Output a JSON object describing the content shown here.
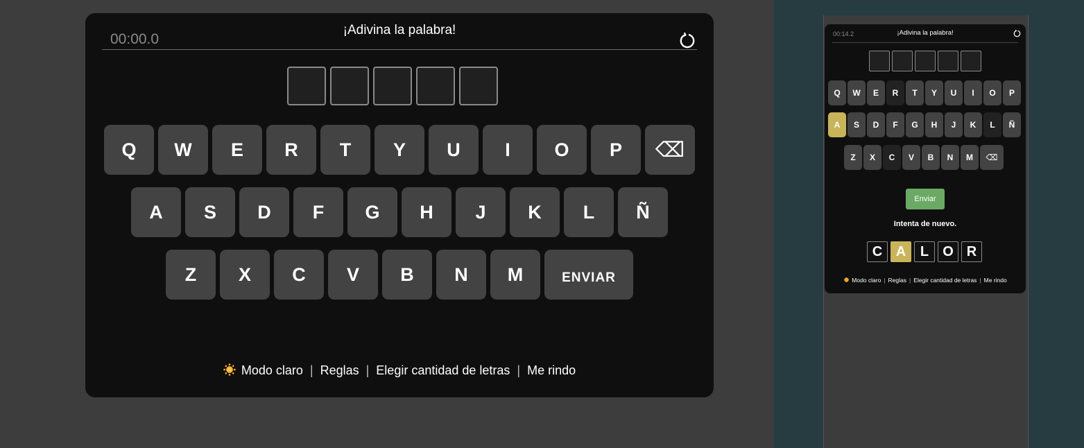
{
  "game": {
    "timer": "00:00.0",
    "title": "¡Adivina la palabra!",
    "keyboard": {
      "row1": [
        "Q",
        "W",
        "E",
        "R",
        "T",
        "Y",
        "U",
        "I",
        "O",
        "P"
      ],
      "backspace": "⌫",
      "row2": [
        "A",
        "S",
        "D",
        "F",
        "G",
        "H",
        "J",
        "K",
        "L",
        "Ñ"
      ],
      "row3": [
        "Z",
        "X",
        "C",
        "V",
        "B",
        "N",
        "M"
      ],
      "send": "ENVIAR"
    },
    "footer": {
      "light_mode": "Modo claro",
      "rules": "Reglas",
      "choose_letters": "Elegir cantidad de letras",
      "give_up": "Me rindo",
      "separator": "|"
    }
  },
  "preview": {
    "timer": "00:14.2",
    "title": "¡Adivina la palabra!",
    "send": "Enviar",
    "message": "Intenta de nuevo.",
    "answer": [
      "C",
      "A",
      "L",
      "O",
      "R"
    ],
    "answer_present_letter": "A",
    "used_letters": [
      "R",
      "L",
      "C"
    ],
    "present_letters": [
      "A"
    ],
    "footer": {
      "light_mode": "Modo claro",
      "rules": "Reglas",
      "choose_letters": "Elegir cantidad de letras",
      "give_up": "Me rindo"
    }
  },
  "colors": {
    "key": "#434343",
    "present": "#c9b458",
    "send_button": "#6aaa64",
    "panel": "#0f0f0f",
    "page_bg": "#3d3d3d",
    "side_bg": "#263c40"
  },
  "icons": [
    "reset-icon",
    "sun-icon",
    "backspace-icon"
  ]
}
